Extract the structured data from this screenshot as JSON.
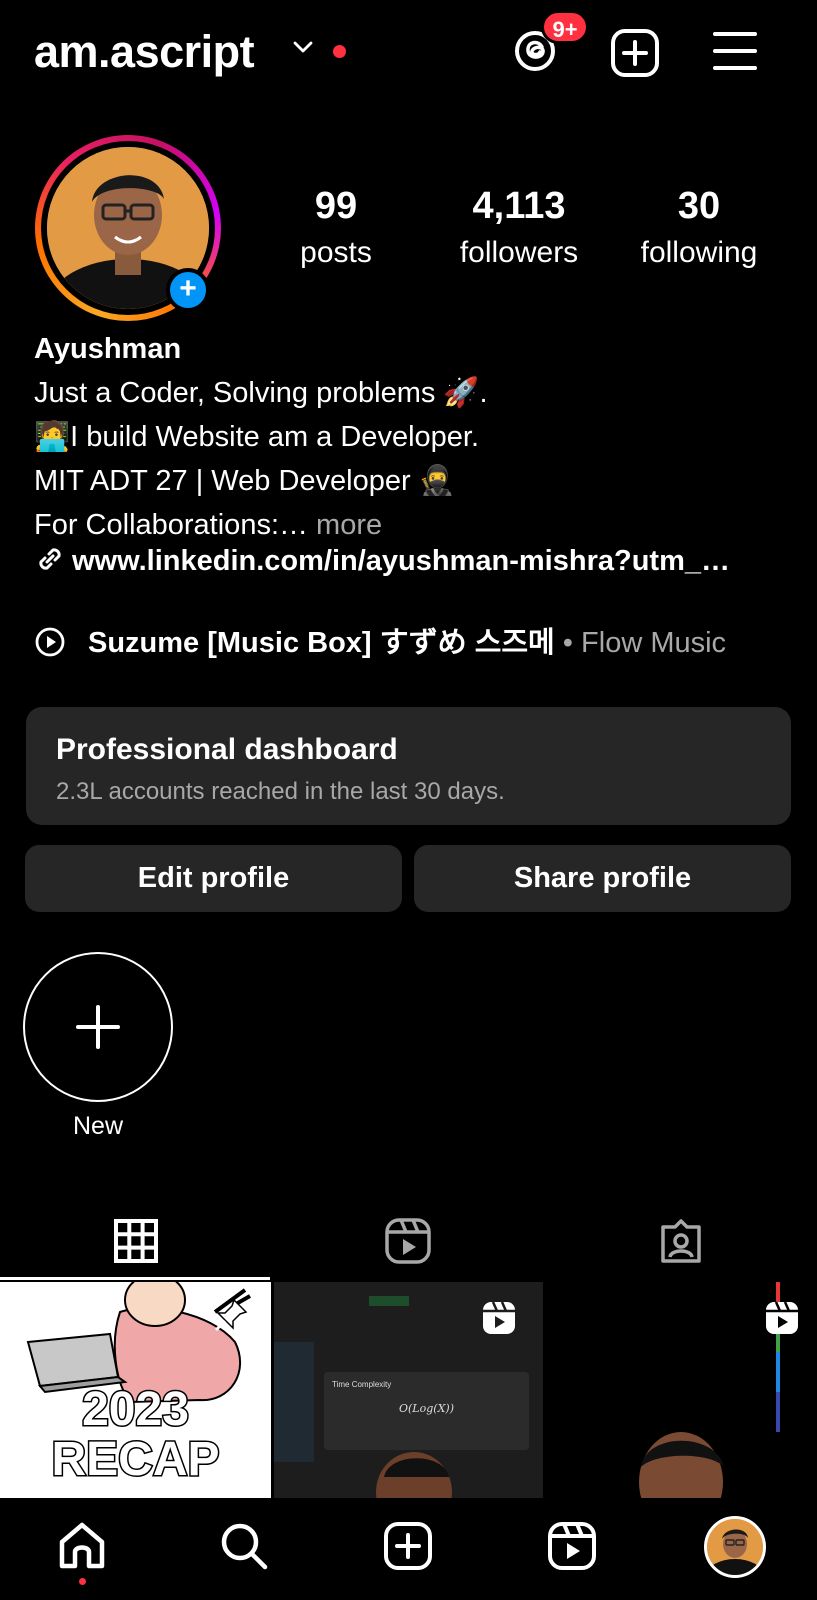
{
  "header": {
    "username": "am.ascript",
    "threads_badge": "9+",
    "icons": [
      "chevron-down-icon",
      "threads-icon",
      "create-post-icon",
      "menu-icon"
    ]
  },
  "profile": {
    "stats": [
      {
        "number": "99",
        "label": "posts"
      },
      {
        "number": "4,113",
        "label": "followers"
      },
      {
        "number": "30",
        "label": "following"
      }
    ],
    "name": "Ayushman",
    "bio_lines": [
      "Just a Coder, Solving problems 🚀.",
      "🧑‍💻I build Website am a Developer.",
      "MIT ADT 27 | Web Developer 🥷"
    ],
    "bio_last_prefix": "For Collaborations:…",
    "bio_more": " more",
    "link": "www.linkedin.com/in/ayushman-mishra?utm_…",
    "music": {
      "title": "Suzume [Music Box] すずめ 스즈메",
      "separator": " • ",
      "artist": "Flow Music"
    }
  },
  "dashboard": {
    "title": "Professional dashboard",
    "subtitle": "2.3L accounts reached in the last 30 days."
  },
  "buttons": {
    "edit": "Edit profile",
    "share": "Share profile"
  },
  "highlights": {
    "new_label": "New"
  },
  "tabs": [
    "grid-icon",
    "reels-icon",
    "tagged-icon"
  ],
  "posts": {
    "recap_year": "2023",
    "recap_word": "RECAP",
    "modal_title": "Time Complexity",
    "modal_formula": "O(Log(X))"
  },
  "colors": {
    "background": "#000000",
    "surface": "#262626",
    "accent_red": "#ff3040",
    "accent_blue": "#0095f6",
    "muted_text": "#a8a8a8"
  }
}
